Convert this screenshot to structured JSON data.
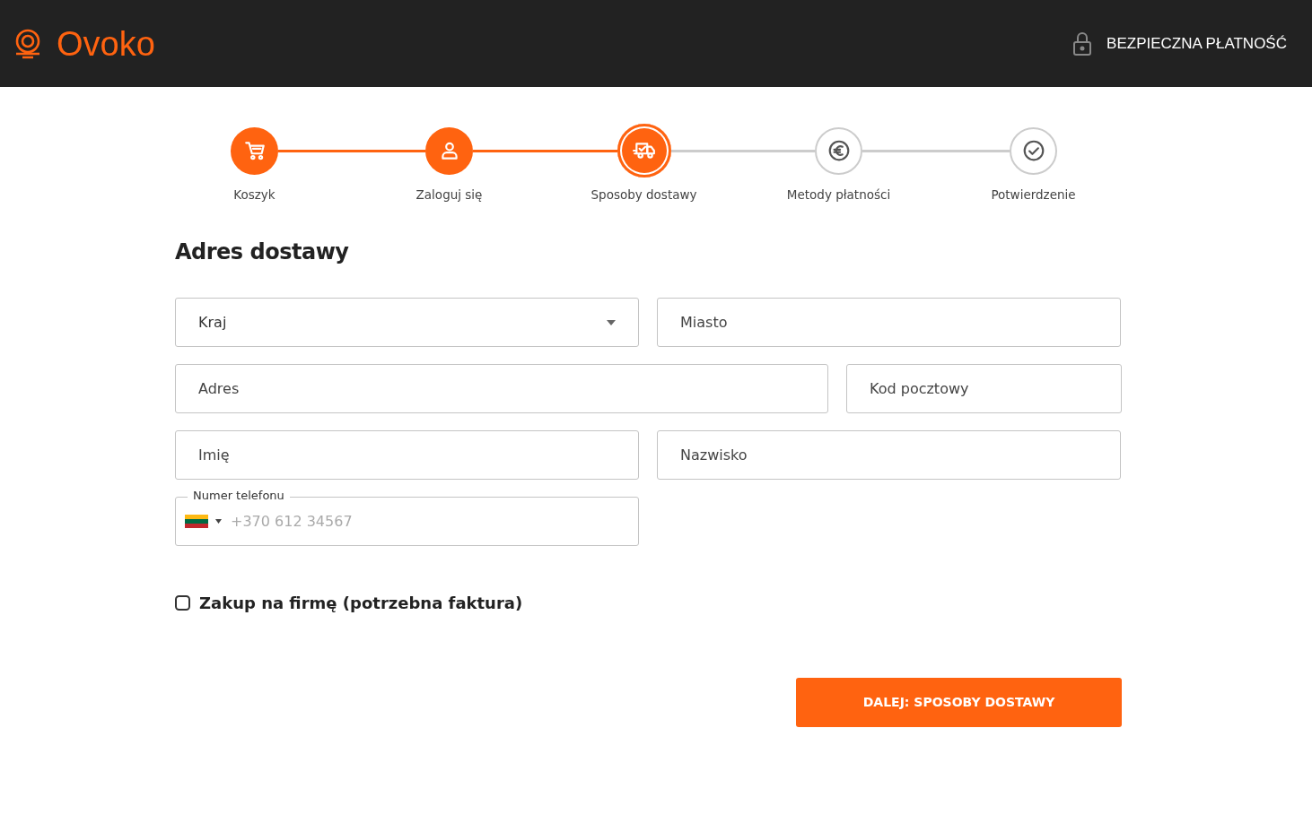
{
  "header": {
    "logo": "Ovoko",
    "secure_label": "BEZPIECZNA PŁATNOŚĆ"
  },
  "steps": [
    {
      "label": "Koszyk",
      "kind": "cart",
      "done": true,
      "selected": false
    },
    {
      "label": "Zaloguj się",
      "kind": "user",
      "done": true,
      "selected": false
    },
    {
      "label": "Sposoby dostawy",
      "kind": "delivery",
      "done": false,
      "selected": true
    },
    {
      "label": "Metody płatności",
      "kind": "payment",
      "done": false,
      "selected": false
    },
    {
      "label": "Potwierdzenie",
      "kind": "confirm",
      "done": false,
      "selected": false
    }
  ],
  "form": {
    "title": "Adres dostawy",
    "rows": [
      {
        "kind": "even",
        "fields": [
          {
            "kind": "select",
            "placeholder": "Kraj"
          },
          {
            "kind": "text",
            "placeholder": "Miasto"
          }
        ]
      },
      {
        "kind": "uneven",
        "fields": [
          {
            "kind": "text",
            "placeholder": "Adres"
          },
          {
            "kind": "text",
            "placeholder": "Kod pocztowy"
          }
        ]
      },
      {
        "kind": "even",
        "fields": [
          {
            "kind": "text",
            "placeholder": "Imię"
          },
          {
            "kind": "text",
            "placeholder": "Nazwisko"
          }
        ]
      },
      {
        "kind": "even",
        "fields": [
          {
            "kind": "phone",
            "label": "Numer telefonu",
            "placeholder": "+370 612 34567"
          }
        ]
      }
    ],
    "company_checkbox": {
      "label": "Zakup na firmę (potrzebna faktura)",
      "checked": false
    },
    "submit": "DALEJ: SPOSOBY DOSTAWY"
  }
}
